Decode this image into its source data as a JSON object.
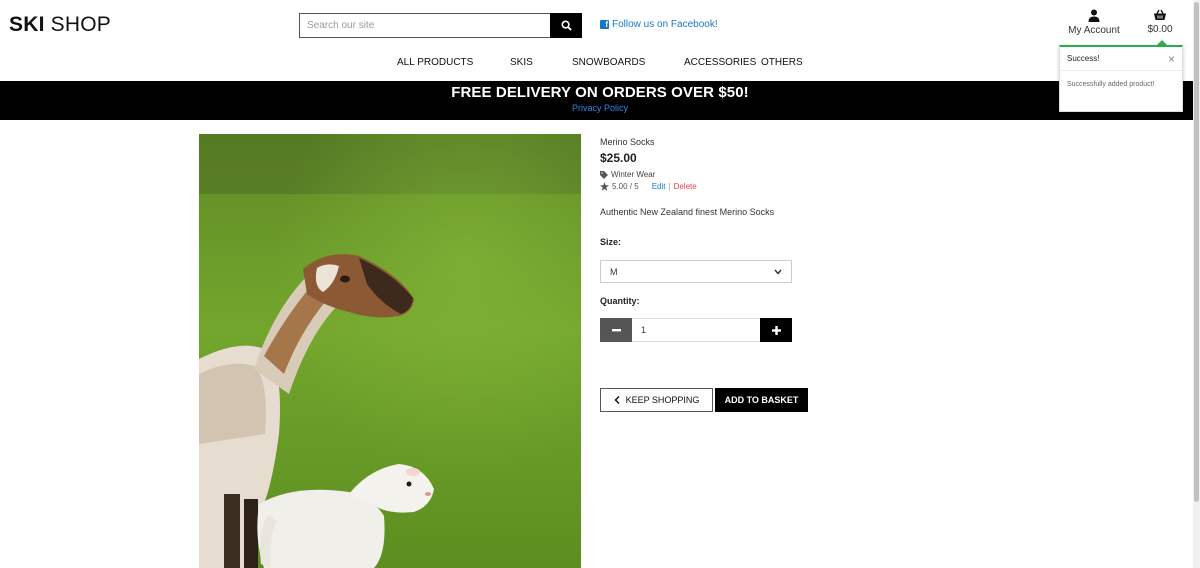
{
  "header": {
    "logo_bold": "SKI",
    "logo_rest": " SHOP",
    "search_placeholder": "Search our site",
    "facebook_link": "Follow us on Facebook!",
    "account_label": "My Account",
    "basket_total": "$0.00"
  },
  "nav": {
    "items": [
      "ALL PRODUCTS",
      "SKIS",
      "SNOWBOARDS",
      "ACCESSORIES",
      "OTHERS"
    ]
  },
  "banner": {
    "title": "FREE DELIVERY ON ORDERS OVER $50!",
    "link": "Privacy Policy"
  },
  "toast": {
    "title": "Success!",
    "close": "×",
    "message": "Successfully added product!"
  },
  "product": {
    "name": "Merino Socks",
    "price": "$25.00",
    "category": "Winter Wear",
    "rating": "5.00 / 5",
    "edit": "Edit",
    "separator": "|",
    "delete": "Delete",
    "description": "Authentic New Zealand finest Merino Socks",
    "size_label": "Size:",
    "size_value": "M",
    "quantity_label": "Quantity:",
    "quantity_value": "1",
    "keep_shopping": "KEEP SHOPPING",
    "add_to_basket": "ADD TO BASKET"
  },
  "colors": {
    "accent_link": "#1877c9",
    "delete": "#e0454d",
    "success": "#2eaa4f",
    "banner_bg": "#000000"
  },
  "icons": {
    "search": "search-icon",
    "facebook": "facebook-icon",
    "account": "user-icon",
    "basket": "basket-icon",
    "category": "tag-icon",
    "rating": "star-icon",
    "minus": "minus-icon",
    "plus": "plus-icon",
    "back": "chevron-left-icon"
  }
}
